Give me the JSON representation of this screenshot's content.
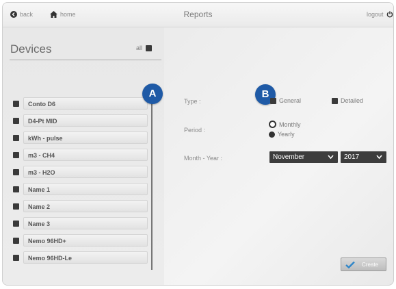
{
  "header": {
    "back_label": "back",
    "home_label": "home",
    "title": "Reports",
    "logout_label": "logout"
  },
  "devices": {
    "title": "Devices",
    "all_label": "all",
    "items": [
      {
        "label": "Conto D6"
      },
      {
        "label": "D4-Pt MID"
      },
      {
        "label": "kWh - pulse"
      },
      {
        "label": "m3 - CH4"
      },
      {
        "label": "m3 - H2O"
      },
      {
        "label": "Name 1"
      },
      {
        "label": "Name 2"
      },
      {
        "label": "Name 3"
      },
      {
        "label": "Nemo 96HD+"
      },
      {
        "label": "Nemo 96HD-Le"
      }
    ]
  },
  "badges": {
    "a": "A",
    "b": "B"
  },
  "form": {
    "type_label": "Type :",
    "type_general": "General",
    "type_detailed": "Detailed",
    "period_label": "Period :",
    "period_monthly": "Monthly",
    "period_yearly": "Yearly",
    "month_year_label": "Month - Year :",
    "month_value": "November",
    "year_value": "2017",
    "create_label": "Create"
  },
  "colors": {
    "badge": "#1f5aa6",
    "dark_control": "#3d3d3d"
  }
}
